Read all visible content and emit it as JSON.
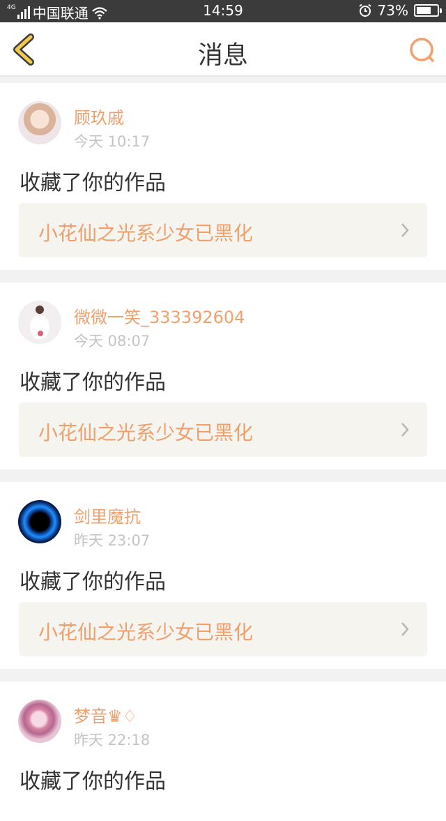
{
  "status_bar": {
    "network_tag": "4G",
    "carrier": "中国联通",
    "time": "14:59",
    "battery_percent_text": "73%",
    "battery_level": 0.73,
    "icons": [
      "signal-icon",
      "wifi-icon",
      "alarm-icon",
      "battery-icon"
    ]
  },
  "header": {
    "title": "消息",
    "back_icon": "chevron-left-icon",
    "search_icon": "search-icon"
  },
  "colors": {
    "accent": "#f0a06c",
    "back_arrow": "#f2c94c",
    "text_primary": "#333333",
    "text_secondary": "#c4c4c4",
    "link_bg": "#f5f4ef",
    "page_bg": "#f2f2f2"
  },
  "messages": [
    {
      "username": "顾玖戚",
      "time": "今天 10:17",
      "action": "收藏了你的作品",
      "work_title": "小花仙之光系少女已黑化",
      "avatar": "girl-portrait-avatar"
    },
    {
      "username": "微微一笑_333392604",
      "time": "今天 08:07",
      "action": "收藏了你的作品",
      "work_title": "小花仙之光系少女已黑化",
      "avatar": "dancer-avatar"
    },
    {
      "username": "剑里魔抗",
      "time": "昨天 23:07",
      "action": "收藏了你的作品",
      "work_title": "小花仙之光系少女已黑化",
      "avatar": "blue-orb-avatar"
    },
    {
      "username": "梦音♛♢",
      "time": "昨天 22:18",
      "action": "收藏了你的作品",
      "work_title": "",
      "avatar": "anime-girl-avatar"
    }
  ]
}
